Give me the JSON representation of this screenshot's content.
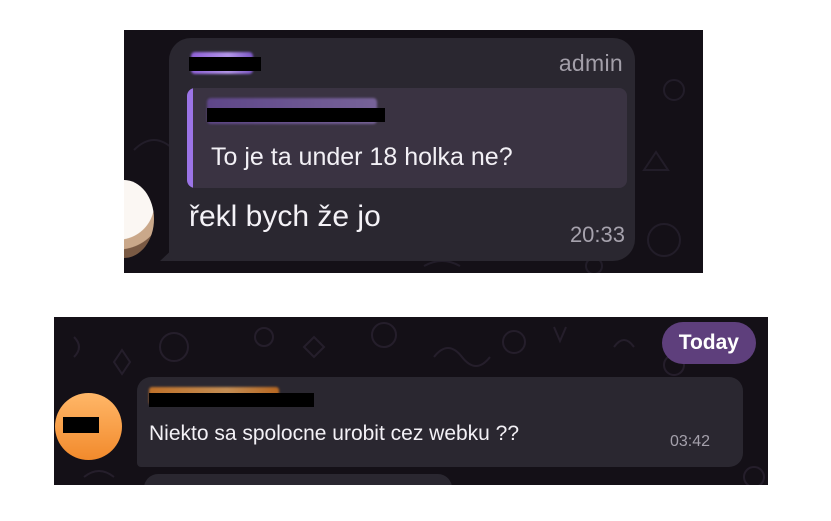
{
  "top_chat": {
    "sender_name": "",
    "role_badge": "admin",
    "reply": {
      "quoted_sender": "",
      "quoted_text": "To je ta under 18 holka ne?"
    },
    "message_text": "řekl bych že jo",
    "message_time": "20:33"
  },
  "bottom_chat": {
    "date_badge": "Today",
    "avatar_text": "",
    "sender_name": "",
    "message_text": "Niekto sa spolocne urobit cez webku ??",
    "message_time": "03:42"
  },
  "colors": {
    "chat_background": "#141017",
    "bubble": "#2a2730",
    "quote_accent": "#9b74e6",
    "date_badge_bg": "#5e3f7c",
    "avatar_orange": "#f28a2c"
  }
}
